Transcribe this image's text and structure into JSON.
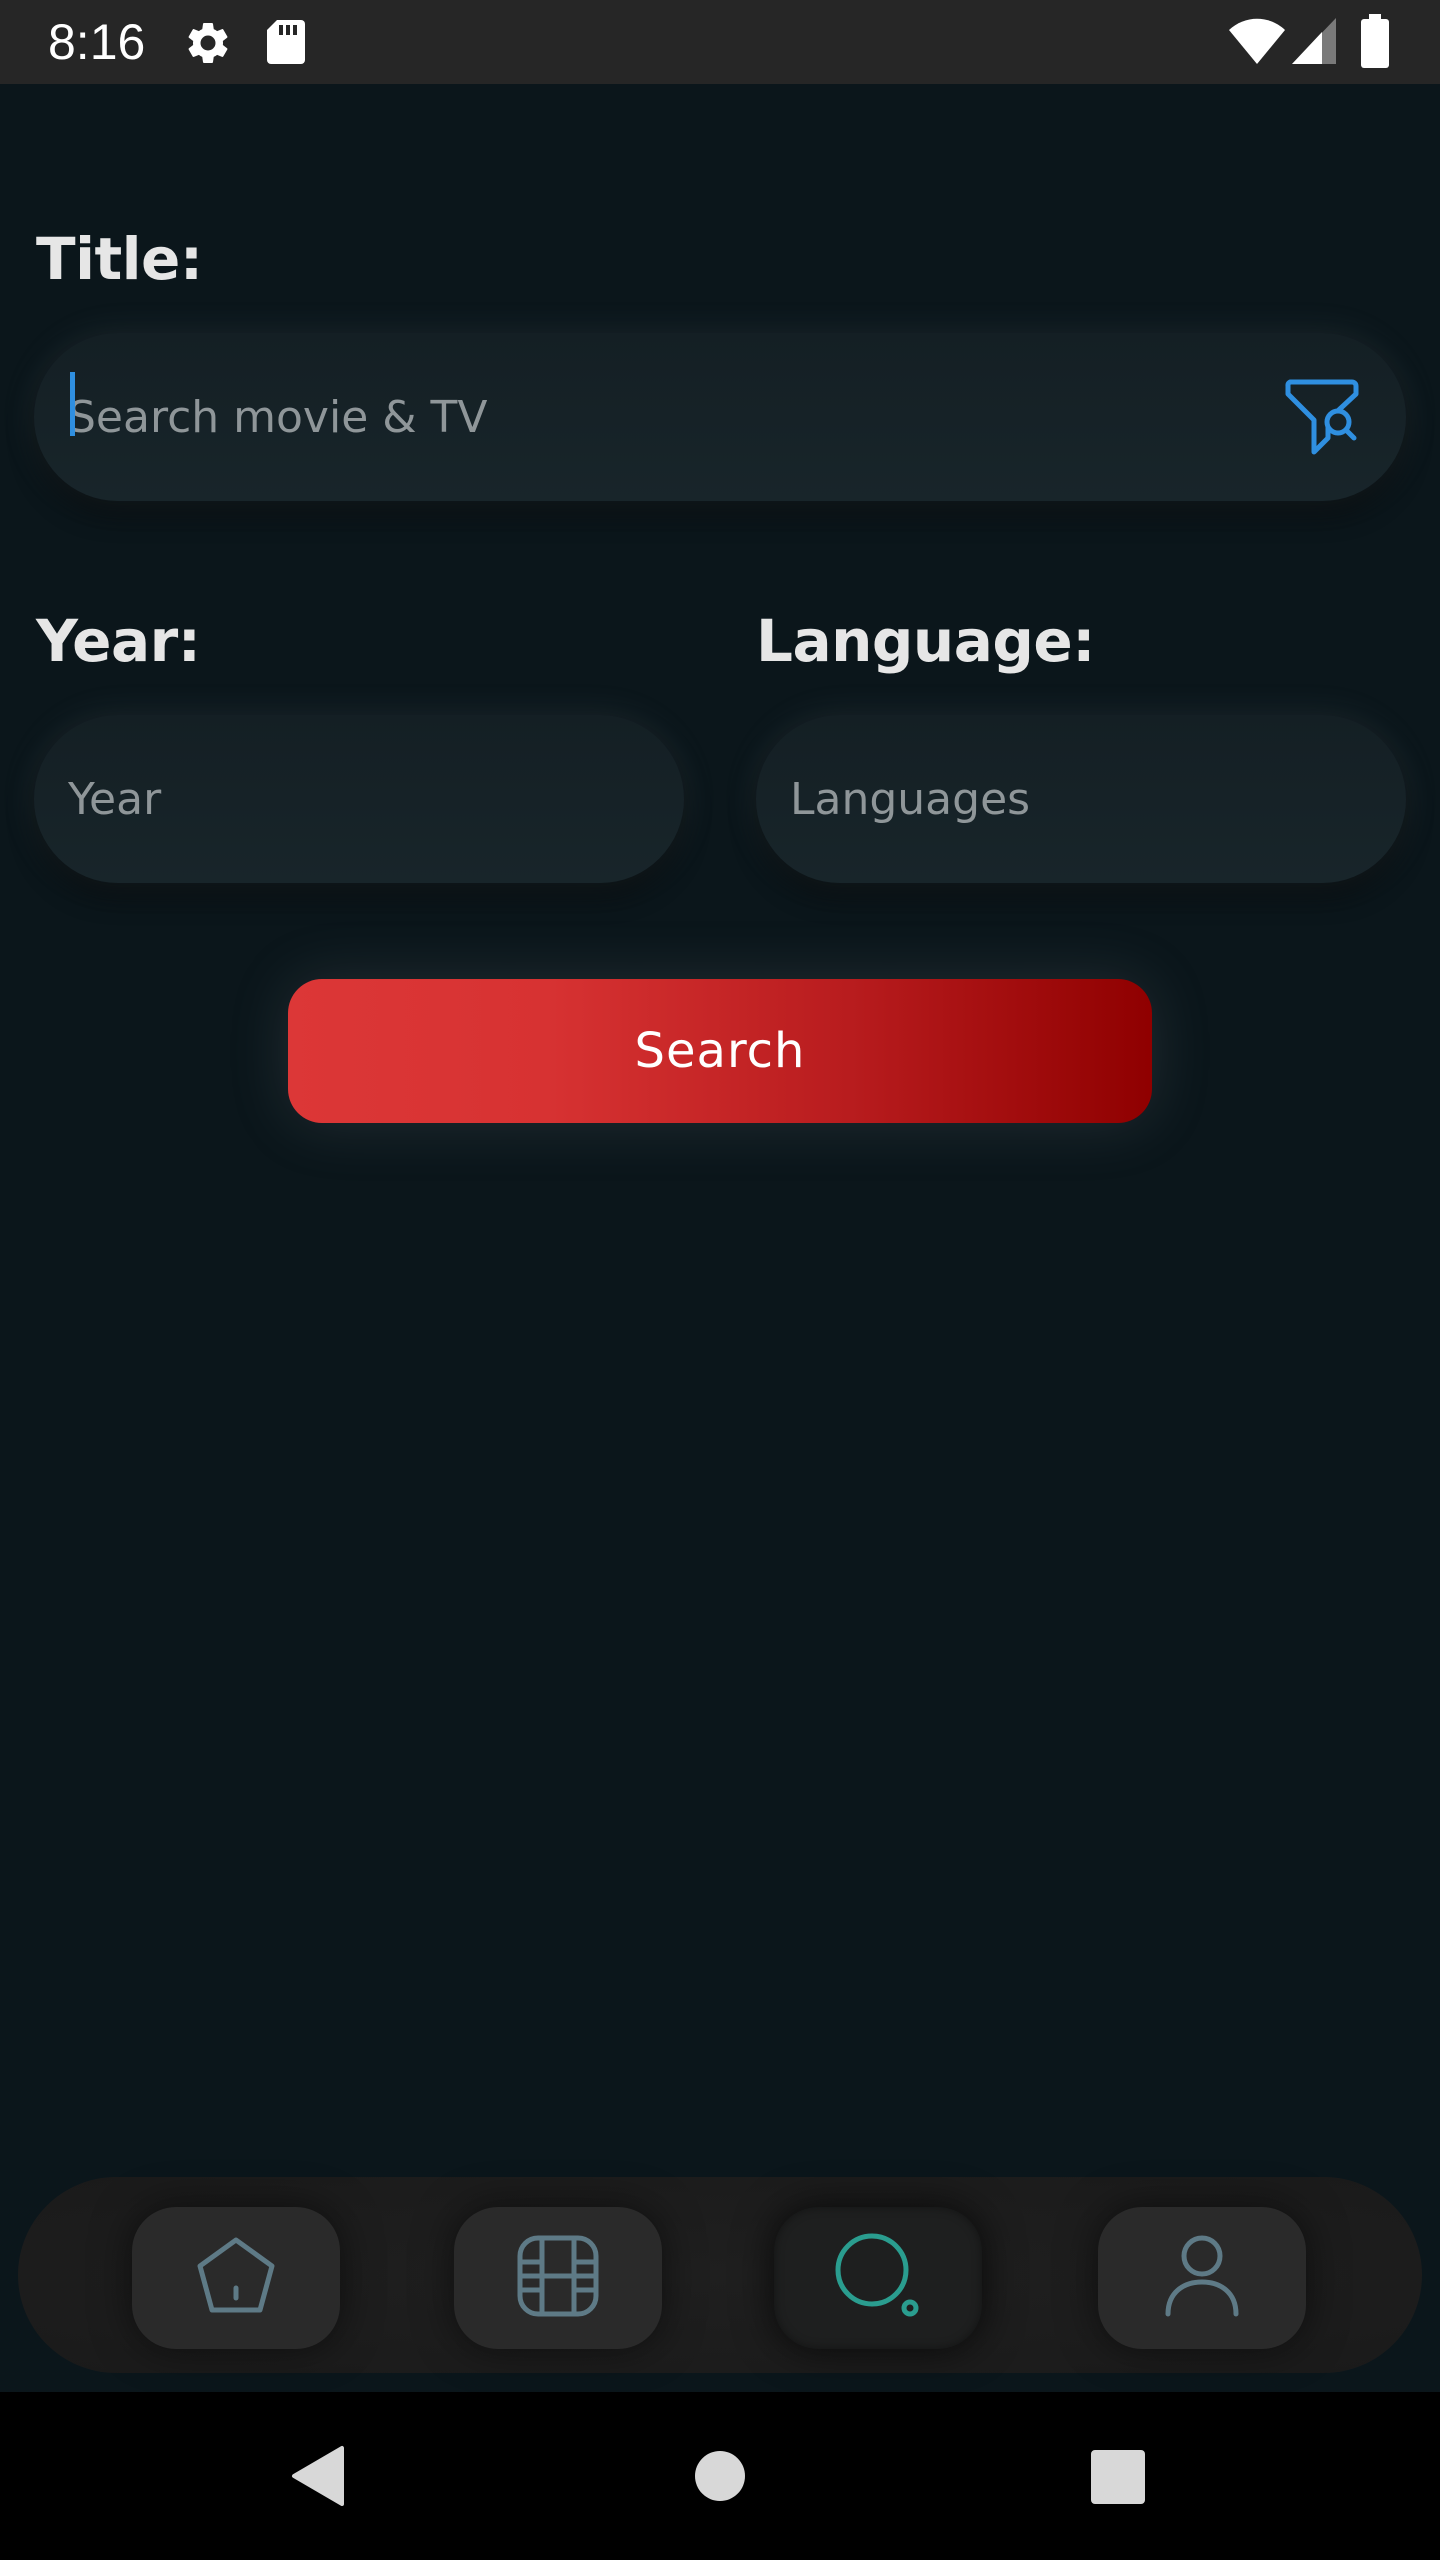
{
  "status_bar": {
    "time": "8:16",
    "icons": [
      "settings-gear-icon",
      "sd-card-icon",
      "wifi-icon",
      "cell-signal-icon",
      "battery-icon"
    ]
  },
  "form": {
    "title": {
      "label": "Title:",
      "placeholder": "Search movie & TV",
      "filter_icon": "filter-search-icon"
    },
    "year": {
      "label": "Year:",
      "placeholder": "Year"
    },
    "language": {
      "label": "Language:",
      "placeholder": "Languages"
    },
    "search_button": "Search"
  },
  "bottom_nav": {
    "items": [
      {
        "icon": "home-icon",
        "active": false
      },
      {
        "icon": "film-icon",
        "active": false
      },
      {
        "icon": "search-icon",
        "active": true
      },
      {
        "icon": "profile-icon",
        "active": false
      }
    ]
  },
  "system_nav": [
    "back-icon",
    "home-circle-icon",
    "recents-square-icon"
  ],
  "colors": {
    "background": "#0b161b",
    "field": "#18252a",
    "search_gradient_start": "#dc3737",
    "search_gradient_end": "#8f0000",
    "accent_blue": "#2f8fe0",
    "active_nav_teal": "#2a9d8f",
    "inactive_nav_icon": "#5e7a86"
  }
}
